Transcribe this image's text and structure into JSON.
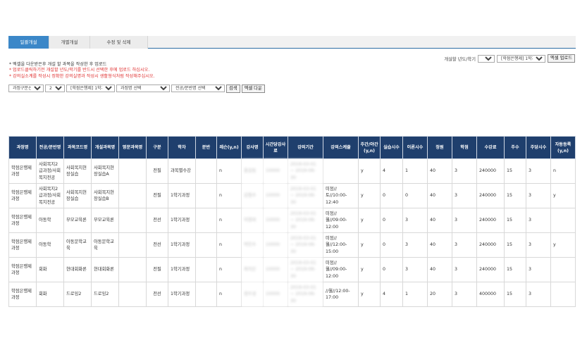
{
  "tabs": [
    {
      "label": "일괄개설",
      "active": true
    },
    {
      "label": "개별개설",
      "active": false
    },
    {
      "label": "수정 및 삭제",
      "active": false
    }
  ],
  "semester_bar": {
    "label": "개설할 년도/학기",
    "year": "2019",
    "term": "[학점은행제] 1학기",
    "upload_button": "엑셀 업로드"
  },
  "notes": [
    "* 엑셀을 다운받은후 개설 할 과목을 작성한 후 업로드",
    "* 업로드클릭하기전 개설할 년도/학기를 반드시 선택한 후에 업로드 하십시오.",
    "* 강의실소계를 작성시 정확한 강의실명과 작성시 생활형식처럼 작성해주십시오."
  ],
  "filters": {
    "course_type": "과정구분선택",
    "year": "2019",
    "term": "[학점은행제] 1학기",
    "course": "과정명 선택",
    "major": "전공/분반명 선택",
    "search_button": "검색",
    "excel_download_button": "엑셀 다운"
  },
  "table": {
    "headers": [
      "과정명",
      "전공/분반명",
      "과목코드명",
      "개설과목명",
      "영문과목명",
      "구분",
      "학차",
      "분반",
      "레슨(y,n)",
      "강사명",
      "시간당강사료",
      "강의기간",
      "강의스케쥴",
      "주간/야간(y,n)",
      "실습시수",
      "이론시수",
      "정원",
      "학점",
      "수강료",
      "주수",
      "주당시수",
      "자동등록(y,n)"
    ],
    "rows": [
      [
        "학점은행제과정",
        "사회복지2급과정/사회복지전공",
        "사회복지현장실습",
        "사회복지현장실습A",
        "",
        "전필",
        "과목별수강",
        "",
        "n",
        "홍길동",
        "10000",
        "2019-03-01 ~ 2019-06-30",
        "",
        "y",
        "4",
        "1",
        "40",
        "3",
        "240000",
        "15",
        "3",
        "n"
      ],
      [
        "학점은행제과정",
        "사회복지2급과정/사회복지전공",
        "사회복지현장실습",
        "사회복지현장실습B",
        "",
        "전필",
        "1학기과정",
        "",
        "n",
        "김철수",
        "10000",
        "2019-03-01 ~ 2019-06-30",
        "미정//토//10:00-12:40",
        "y",
        "0",
        "0",
        "40",
        "3",
        "240000",
        "15",
        "3",
        "y"
      ],
      [
        "학점은행제과정",
        "아동학",
        "부모교육론",
        "부모교육론",
        "",
        "전선",
        "1학기과정",
        "",
        "n",
        "이영희",
        "10000",
        "2019-03-01 ~ 2019-06-30",
        "미정//월//09:00-12:00",
        "y",
        "0",
        "3",
        "40",
        "3",
        "240000",
        "15",
        "3",
        ""
      ],
      [
        "학점은행제과정",
        "아동학",
        "아동문학교육",
        "아동문학교육",
        "",
        "전선",
        "1학기과정",
        "",
        "n",
        "박민수",
        "10000",
        "2019-03-01 ~ 2019-06-30",
        "미정//월//12:00-15:00",
        "y",
        "0",
        "3",
        "40",
        "3",
        "240000",
        "15",
        "3",
        "y"
      ],
      [
        "학점은행제과정",
        "회화",
        "현대회화론",
        "현대회화론",
        "",
        "전필",
        "1학기과정",
        "",
        "n",
        "최지은",
        "10000",
        "2019-03-01 ~ 2019-06-30",
        "미정//월//09:00-12:00",
        "y",
        "0",
        "3",
        "40",
        "3",
        "240000",
        "15",
        "3",
        ""
      ],
      [
        "학점은행제과정",
        "회화",
        "드로잉2",
        "드로잉2",
        "",
        "전선",
        "1학기과정",
        "",
        "n",
        "정우성",
        "10000",
        "2019-03-01 ~ 2019-06-30",
        "//월//12:00-17:00",
        "y",
        "4",
        "1",
        "20",
        "3",
        "400000",
        "15",
        "3",
        ""
      ]
    ]
  }
}
